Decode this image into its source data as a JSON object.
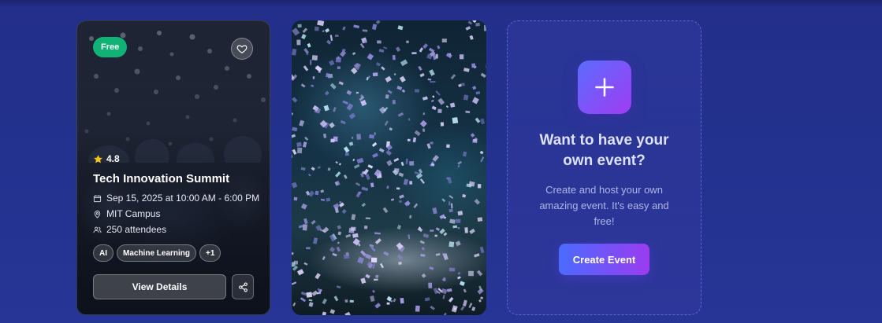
{
  "event_card": {
    "badge": "Free",
    "rating": "4.8",
    "title": "Tech Innovation Summit",
    "date": "Sep 15, 2025 at 10:00 AM - 6:00 PM",
    "location": "MIT Campus",
    "attendees": "250 attendees",
    "tags": [
      "AI",
      "Machine Learning",
      "+1"
    ],
    "view_button": "View Details"
  },
  "create_card": {
    "title_line1": "Want to have your",
    "title_line2": "own event?",
    "desc_line1": "Create and host your own",
    "desc_line2": "amazing event. It's easy and",
    "desc_line3": "free!",
    "button": "Create Event"
  },
  "colors": {
    "background": "#23318e",
    "free_badge": "#10b375",
    "star": "#f5c518",
    "accent_start": "#4a6bff",
    "accent_end": "#9b3cf0"
  },
  "icons": [
    "heart-icon",
    "star-icon",
    "calendar-icon",
    "location-pin-icon",
    "users-icon",
    "share-icon",
    "plus-icon"
  ]
}
